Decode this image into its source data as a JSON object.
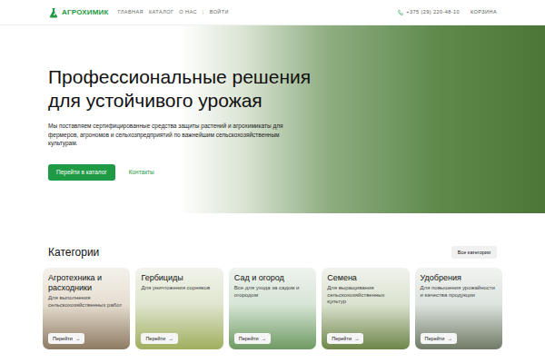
{
  "header": {
    "logo": "АГРОХИМИК",
    "nav": [
      {
        "label": "ГЛАВНАЯ"
      },
      {
        "label": "КАТАЛОГ"
      },
      {
        "label": "О НАС"
      }
    ],
    "separator": "|",
    "login": "ВОЙТИ",
    "phone": "+375 (29) 220-48-10",
    "cart": "КОРЗИНА"
  },
  "hero": {
    "title_lines": [
      "Профессиональные решения",
      "для устойчивого урожая"
    ],
    "text": "Мы поставляем сертифицированные средства защиты растений и агрохимикаты для фермеров, агрономов и сельхозпредприятий по важнейшим сельскохозяйственным культурам.",
    "primary_button": "Перейти в каталог",
    "secondary_button": "Контакты"
  },
  "categories": {
    "title": "Категории",
    "all_button": "Все категории",
    "cards": [
      {
        "title": "Агротехника и расходники",
        "description": "Для выполнения сельскохозяйственных работ",
        "button": "Перейти",
        "arrow": "→"
      },
      {
        "title": "Гербициды",
        "description": "Для уничтожения сорняков",
        "button": "Перейти",
        "arrow": "→"
      },
      {
        "title": "Сад и огород",
        "description": "Все для ухода за садом и огородом",
        "button": "Перейти",
        "arrow": "→"
      },
      {
        "title": "Семена",
        "description": "Для выращивания сельскохозяйственных культур",
        "button": "Перейти",
        "arrow": "→"
      },
      {
        "title": "Удобрения",
        "description": "Для повышения урожайности и качества продукции",
        "button": "Перейти",
        "arrow": "→"
      }
    ]
  }
}
